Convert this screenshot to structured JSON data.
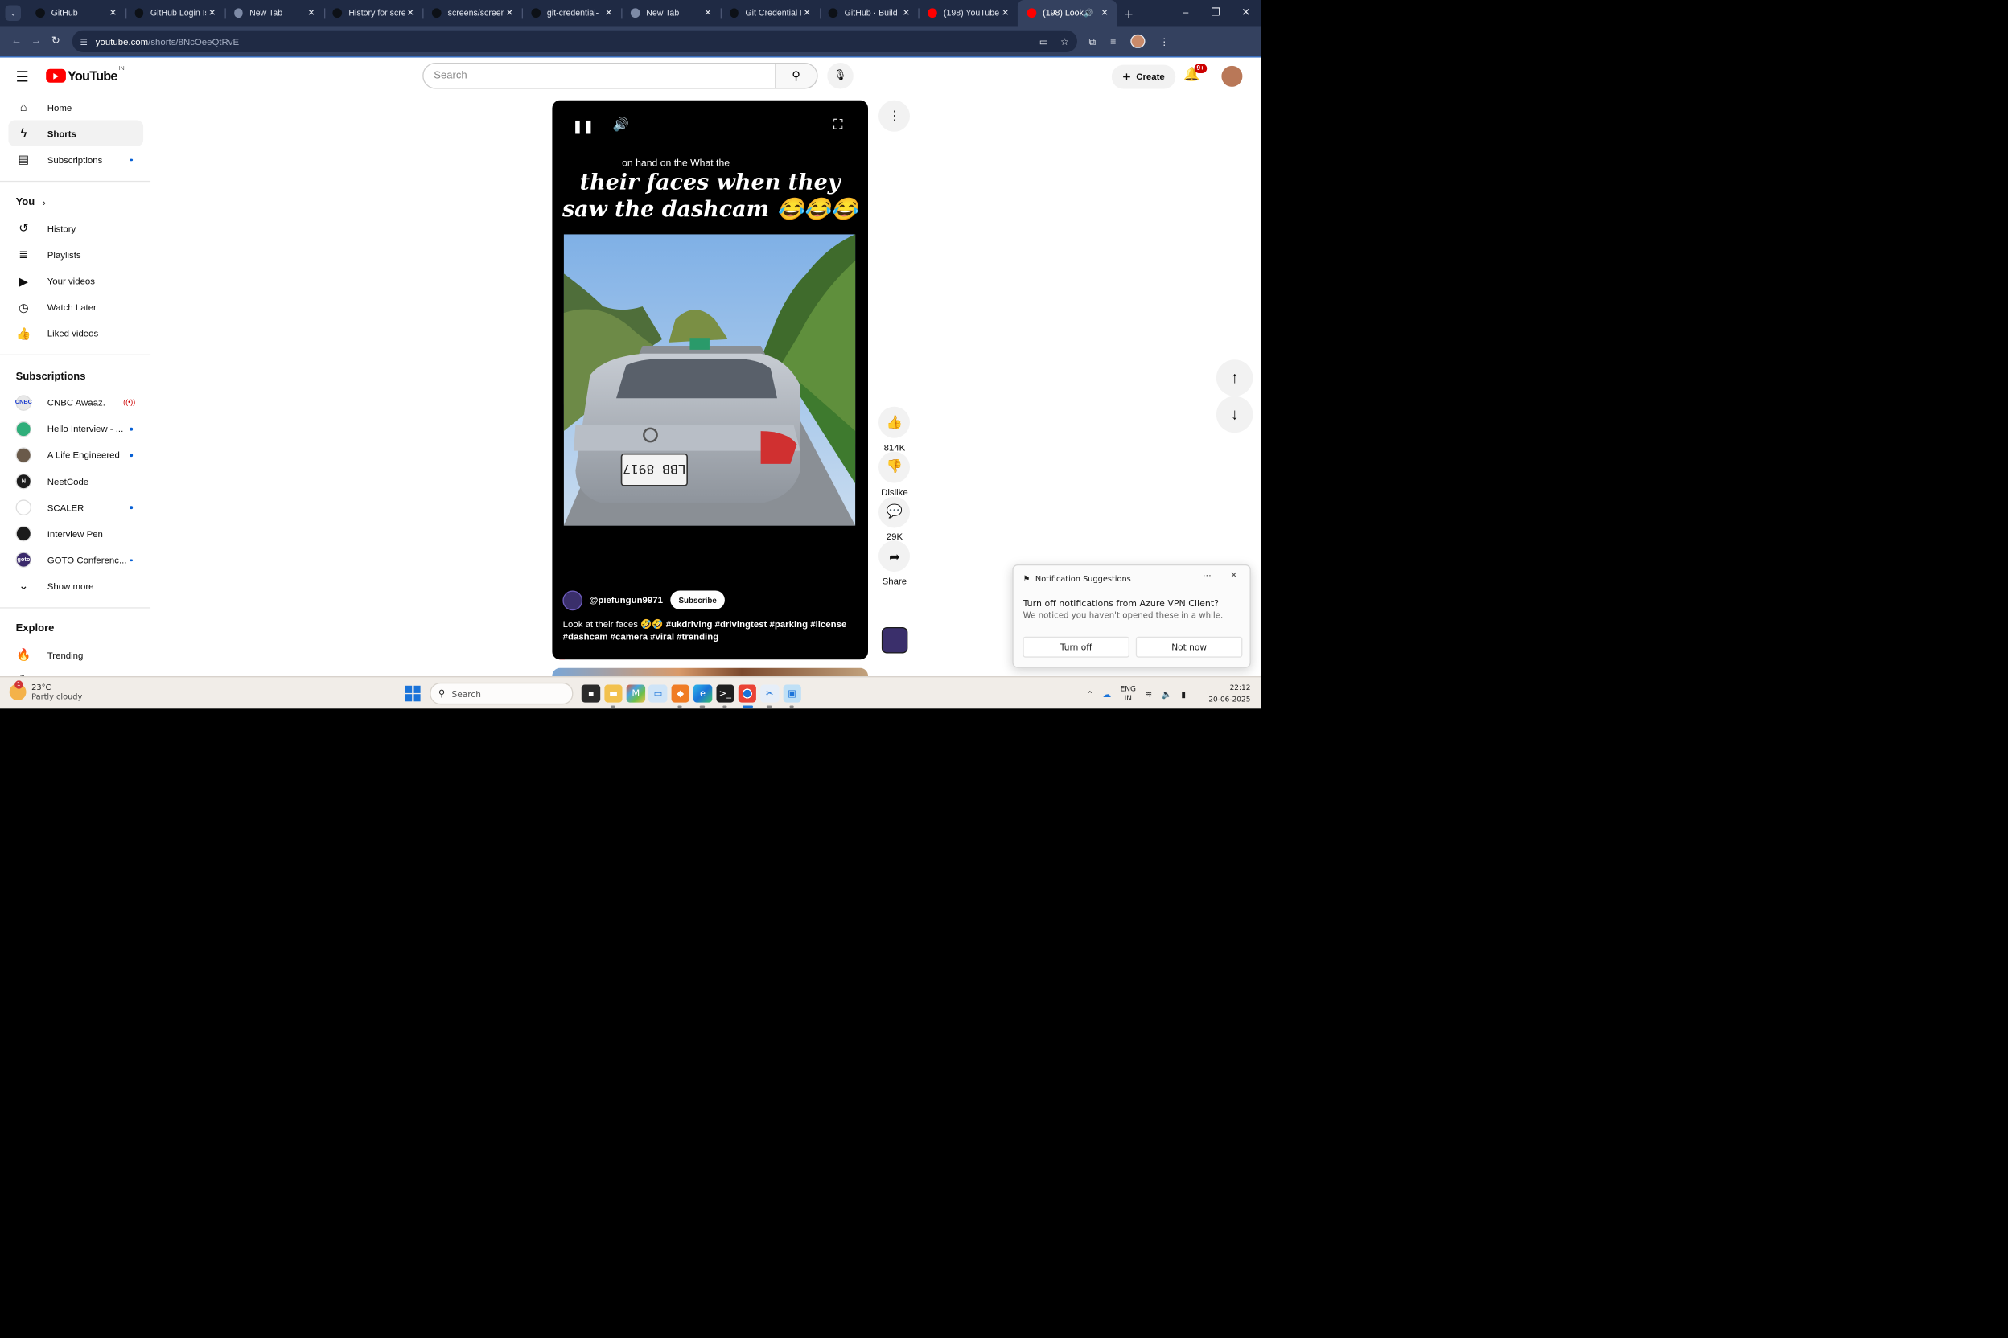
{
  "browser": {
    "tabs": [
      {
        "title": "GitHub",
        "favicon": "github-icon",
        "active": false
      },
      {
        "title": "GitHub Login Is",
        "favicon": "github-icon",
        "active": false
      },
      {
        "title": "New Tab",
        "favicon": "chrome-icon",
        "active": false
      },
      {
        "title": "History for scre",
        "favicon": "github-icon",
        "active": false
      },
      {
        "title": "screens/screen",
        "favicon": "github-icon",
        "active": false
      },
      {
        "title": "git-credential-",
        "favicon": "github-icon",
        "active": false
      },
      {
        "title": "New Tab",
        "favicon": "chrome-icon",
        "active": false
      },
      {
        "title": "Git Credential I",
        "favicon": "github-icon",
        "active": false
      },
      {
        "title": "GitHub · Build",
        "favicon": "github-icon",
        "active": false
      },
      {
        "title": "(198) YouTube",
        "favicon": "youtube-icon",
        "active": false
      },
      {
        "title": "(198) Look",
        "favicon": "youtube-icon",
        "active": true,
        "audio": true
      }
    ],
    "url_host": "youtube.com",
    "url_path": "/shorts/8NcOeeQtRvE"
  },
  "youtube": {
    "logo_text": "YouTube",
    "country_code": "IN",
    "search_placeholder": "Search",
    "create_label": "Create",
    "notif_badge": "9+"
  },
  "sidebar": {
    "main": [
      {
        "label": "Home",
        "icon": "home-icon",
        "active": false
      },
      {
        "label": "Shorts",
        "icon": "shorts-icon",
        "active": true
      },
      {
        "label": "Subscriptions",
        "icon": "subscriptions-icon",
        "active": false,
        "dot": true
      }
    ],
    "you_heading": "You",
    "you": [
      {
        "label": "History",
        "icon": "history-icon"
      },
      {
        "label": "Playlists",
        "icon": "playlists-icon"
      },
      {
        "label": "Your videos",
        "icon": "your-videos-icon"
      },
      {
        "label": "Watch Later",
        "icon": "watch-later-icon"
      },
      {
        "label": "Liked videos",
        "icon": "liked-videos-icon"
      }
    ],
    "subs_heading": "Subscriptions",
    "subscriptions": [
      {
        "label": "CNBC Awaaz.",
        "avatar_color": "#e8e8e8",
        "avatar_text": "CNBC",
        "live": true
      },
      {
        "label": "Hello Interview - ...",
        "avatar_color": "#2fae7a",
        "avatar_text": "",
        "dot": true
      },
      {
        "label": "A Life Engineered",
        "avatar_color": "#6a5a4a",
        "avatar_text": "",
        "dot": true
      },
      {
        "label": "NeetCode",
        "avatar_color": "#1b1b1b",
        "avatar_text": "N",
        "dot": false
      },
      {
        "label": "SCALER",
        "avatar_color": "#ffffff",
        "avatar_text": "",
        "dot": true
      },
      {
        "label": "Interview Pen",
        "avatar_color": "#1b1b1b",
        "avatar_text": "",
        "dot": false
      },
      {
        "label": "GOTO Conferenc...",
        "avatar_color": "#3b2a6b",
        "avatar_text": "goto",
        "dot": true
      }
    ],
    "show_more": "Show more",
    "explore_heading": "Explore",
    "explore": [
      {
        "label": "Trending",
        "icon": "trending-icon"
      },
      {
        "label": "Shopping",
        "icon": "shopping-icon"
      }
    ]
  },
  "short": {
    "caption_small": "on hand on the What the",
    "caption_line1": "their faces when they",
    "caption_line2": "saw the dashcam 😂😂😂",
    "plate_text": "LBB 8917",
    "channel_handle": "@piefungun9971",
    "subscribe_label": "Subscribe",
    "description_lead": "Look at their faces 🤣🤣 ",
    "description_tags": "#ukdriving #drivingtest #parking #license #dashcam #camera #viral #trending",
    "progress_pct": 4
  },
  "actions": {
    "likes": "814K",
    "dislike_label": "Dislike",
    "comments": "29K",
    "share_label": "Share"
  },
  "toast": {
    "app_name": "Notification Suggestions",
    "title": "Turn off notifications from Azure VPN Client?",
    "body": "We noticed you haven't opened these in a while.",
    "primary_label": "Turn off",
    "secondary_label": "Not now"
  },
  "taskbar": {
    "temperature": "23°C",
    "condition": "Partly cloudy",
    "weather_badge": "1",
    "search_placeholder": "Search",
    "lang_line1": "ENG",
    "lang_line2": "IN",
    "time": "22:12",
    "date": "20-06-2025"
  }
}
